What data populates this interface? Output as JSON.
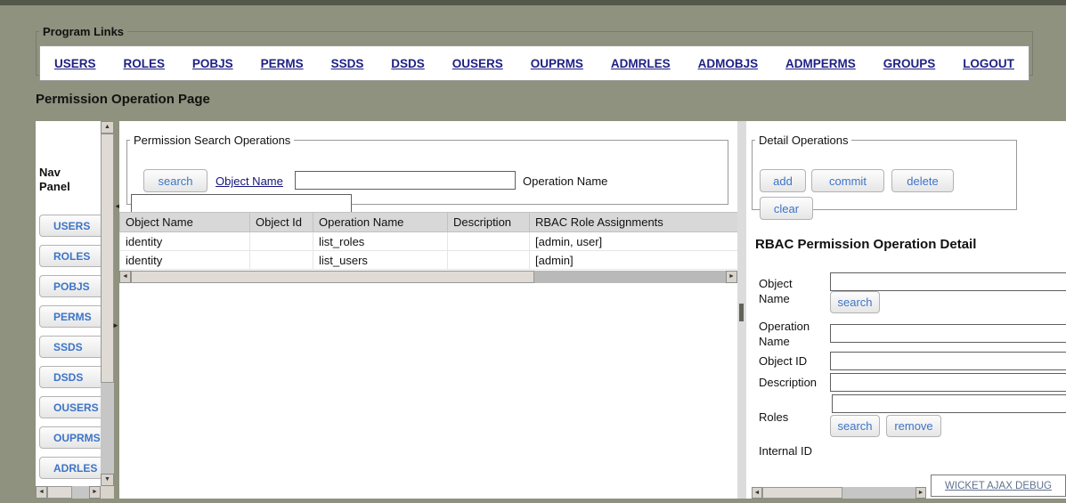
{
  "page": {
    "title": "Permission Operation Page"
  },
  "program_links": {
    "legend": "Program Links",
    "links": [
      "USERS",
      "ROLES",
      "POBJS",
      "PERMS",
      "SSDS",
      "DSDS",
      "OUSERS",
      "OUPRMS",
      "ADMRLES",
      "ADMOBJS",
      "ADMPERMS",
      "GROUPS",
      "LOGOUT"
    ]
  },
  "nav_panel": {
    "title": "Nav Panel",
    "items": [
      "USERS",
      "ROLES",
      "POBJS",
      "PERMS",
      "SSDS",
      "DSDS",
      "OUSERS",
      "OUPRMS",
      "ADRLES"
    ]
  },
  "search_section": {
    "legend": "Permission Search Operations",
    "search_button": "search",
    "object_name_link": "Object Name",
    "object_name_value": "",
    "operation_name_label": "Operation Name",
    "operation_name_value": ""
  },
  "results_table": {
    "headers": [
      "Object Name",
      "Object Id",
      "Operation Name",
      "Description",
      "RBAC Role Assignments"
    ],
    "rows": [
      [
        "identity",
        "",
        "list_roles",
        "",
        "[admin, user]"
      ],
      [
        "identity",
        "",
        "list_users",
        "",
        "[admin]"
      ]
    ]
  },
  "detail_section": {
    "legend": "Detail Operations",
    "add_button": "add",
    "commit_button": "commit",
    "delete_button": "delete",
    "clear_button": "clear",
    "heading": "RBAC Permission Operation Detail",
    "object_name_label": "Object Name",
    "object_name_value": "",
    "object_name_search_button": "search",
    "operation_name_label": "Operation Name",
    "operation_name_value": "",
    "object_id_label": "Object ID",
    "object_id_value": "",
    "description_label": "Description",
    "description_value": "",
    "roles_label": "Roles",
    "roles_value": "",
    "roles_search_button": "search",
    "roles_remove_button": "remove",
    "internal_id_label": "Internal ID"
  },
  "footer": {
    "wicket_link": "WICKET AJAX DEBUG"
  },
  "colors": {
    "page_background": "#8e927e",
    "top_bar": "#53584a",
    "panel_background": "#ffffff",
    "link_navy": "#1f1f85",
    "button_text_blue": "#3d74c6",
    "table_header_bg": "#d8d8d8"
  },
  "icons": {
    "scroll_up": "▲",
    "scroll_down": "▼",
    "scroll_left": "◄",
    "scroll_right": "►",
    "collapse_left": "◄",
    "expand_right": "►"
  }
}
